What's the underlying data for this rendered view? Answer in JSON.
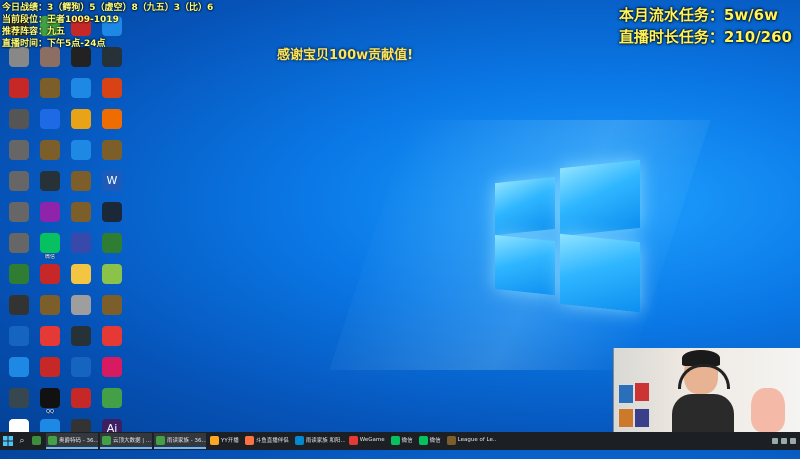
{
  "stats": {
    "line1": "今日战绩：3（鳄狗）5（虚空）8（九五）3（比）6",
    "line2": "当前段位：王者1009-1019",
    "line3": "推荐阵容：九五",
    "line4": "直播时间：下午5点-24点"
  },
  "tasks": {
    "flow": "本月流水任务：5w/6w",
    "duration": "直播时长任务：210/260"
  },
  "thanks": "感谢宝贝100w贡献值!",
  "icons": [
    {
      "label": "",
      "glyph": "",
      "color": "#333333"
    },
    {
      "label": "",
      "glyph": "",
      "color": "#888888"
    },
    {
      "label": "",
      "glyph": "",
      "color": "#c62828"
    },
    {
      "label": "",
      "glyph": "",
      "color": "#555555"
    },
    {
      "label": "",
      "glyph": "",
      "color": "#666666"
    },
    {
      "label": "",
      "glyph": "",
      "color": "#666666"
    },
    {
      "label": "",
      "glyph": "",
      "color": "#666666"
    },
    {
      "label": "",
      "glyph": "",
      "color": "#666666"
    },
    {
      "label": "",
      "glyph": "",
      "color": "#2e7d32"
    },
    {
      "label": "",
      "glyph": "",
      "color": "#333333"
    },
    {
      "label": "",
      "glyph": "",
      "color": "#1565c0"
    },
    {
      "label": "",
      "glyph": "",
      "color": "#1e88e5"
    },
    {
      "label": "",
      "glyph": "",
      "color": "#37474f"
    },
    {
      "label": "",
      "glyph": "",
      "color": "#ffffff"
    },
    {
      "label": "",
      "glyph": "",
      "color": "#43a047"
    },
    {
      "label": "",
      "glyph": "",
      "color": "#8d6e63"
    },
    {
      "label": "",
      "glyph": "",
      "color": "#7b5e2a"
    },
    {
      "label": "",
      "glyph": "",
      "color": "#1e6ae6"
    },
    {
      "label": "",
      "glyph": "",
      "color": "#7b5e2a"
    },
    {
      "label": "",
      "glyph": "",
      "color": "#263238"
    },
    {
      "label": "",
      "glyph": "",
      "color": "#8e24aa"
    },
    {
      "label": "微信",
      "glyph": "",
      "color": "#07c160"
    },
    {
      "label": "",
      "glyph": "",
      "color": "#c62828"
    },
    {
      "label": "",
      "glyph": "",
      "color": "#7b5e2a"
    },
    {
      "label": "",
      "glyph": "",
      "color": "#e53935"
    },
    {
      "label": "",
      "glyph": "",
      "color": "#c62828"
    },
    {
      "label": "QQ",
      "glyph": "",
      "color": "#111111"
    },
    {
      "label": "",
      "glyph": "",
      "color": "#1e88e5"
    },
    {
      "label": "",
      "glyph": "",
      "color": "#c62828"
    },
    {
      "label": "",
      "glyph": "",
      "color": "#222222"
    },
    {
      "label": "",
      "glyph": "",
      "color": "#1e88e5"
    },
    {
      "label": "",
      "glyph": "",
      "color": "#e8a317"
    },
    {
      "label": "",
      "glyph": "",
      "color": "#1e88e5"
    },
    {
      "label": "",
      "glyph": "",
      "color": "#7b5e2a"
    },
    {
      "label": "",
      "glyph": "",
      "color": "#7b5e2a"
    },
    {
      "label": "",
      "glyph": "",
      "color": "#3949ab"
    },
    {
      "label": "",
      "glyph": "",
      "color": "#f4c542"
    },
    {
      "label": "",
      "glyph": "",
      "color": "#9e9e9e"
    },
    {
      "label": "",
      "glyph": "",
      "color": "#263238"
    },
    {
      "label": "",
      "glyph": "",
      "color": "#1565c0"
    },
    {
      "label": "",
      "glyph": "",
      "color": "#c62828"
    },
    {
      "label": "",
      "glyph": "",
      "color": "#333333"
    },
    {
      "label": "",
      "glyph": "",
      "color": "#1e88e5"
    },
    {
      "label": "",
      "glyph": "",
      "color": "#263238"
    },
    {
      "label": "",
      "glyph": "",
      "color": "#d84315"
    },
    {
      "label": "",
      "glyph": "",
      "color": "#ef6c00"
    },
    {
      "label": "",
      "glyph": "",
      "color": "#7b5e2a"
    },
    {
      "label": "",
      "glyph": "W",
      "color": "#1e5bb8"
    },
    {
      "label": "",
      "glyph": "",
      "color": "#1b2838"
    },
    {
      "label": "",
      "glyph": "",
      "color": "#2e7d32"
    },
    {
      "label": "",
      "glyph": "",
      "color": "#8bc34a"
    },
    {
      "label": "",
      "glyph": "",
      "color": "#7b5e2a"
    },
    {
      "label": "",
      "glyph": "",
      "color": "#e53935"
    },
    {
      "label": "",
      "glyph": "",
      "color": "#d81b60"
    },
    {
      "label": "",
      "glyph": "",
      "color": "#43a047"
    },
    {
      "label": "",
      "glyph": "Ai",
      "color": "#3d1f64"
    }
  ],
  "taskbar": {
    "items": [
      {
        "label": "",
        "color": "#3c8d3c",
        "active": false
      },
      {
        "label": "奥爵特码 - 36...",
        "color": "#43a047",
        "active": true
      },
      {
        "label": "云顶大数据 | ...",
        "color": "#43a047",
        "active": true
      },
      {
        "label": "雨读家族 - 36...",
        "color": "#43a047",
        "active": true
      },
      {
        "label": "YY开播",
        "color": "#f9a825",
        "active": false
      },
      {
        "label": "斗鱼直播伴侣",
        "color": "#ff7043",
        "active": false
      },
      {
        "label": "雨读家族 和阳...",
        "color": "#0288d1",
        "active": false
      },
      {
        "label": "WeGame",
        "color": "#e53935",
        "active": false
      },
      {
        "label": "微信",
        "color": "#07c160",
        "active": false
      },
      {
        "label": "微信",
        "color": "#07c160",
        "active": false
      },
      {
        "label": "League of Le...",
        "color": "#7b5e2a",
        "active": false
      }
    ]
  }
}
